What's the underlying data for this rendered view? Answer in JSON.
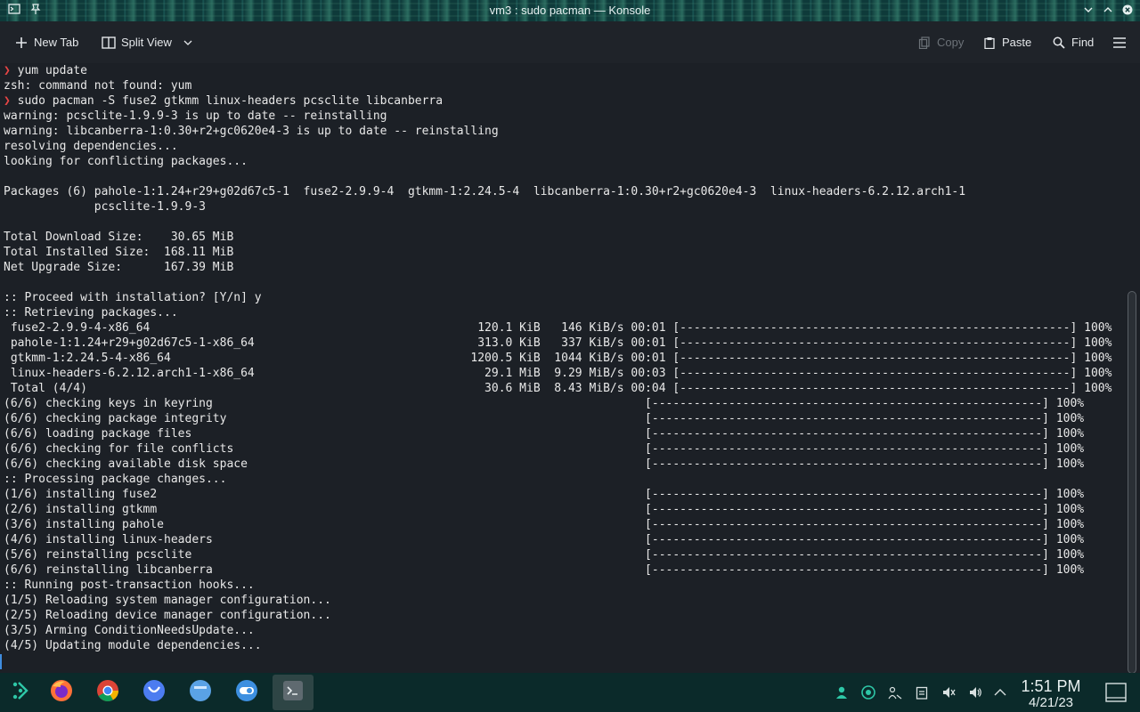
{
  "window": {
    "title": "vm3 : sudo pacman — Konsole"
  },
  "toolbar": {
    "new_tab": "New Tab",
    "split_view": "Split View",
    "copy": "Copy",
    "paste": "Paste",
    "find": "Find"
  },
  "terminal": {
    "lines": [
      {
        "prompt": "❯",
        "text": " yum update"
      },
      {
        "text": "zsh: command not found: yum"
      },
      {
        "prompt": "❯",
        "text": " sudo pacman -S fuse2 gtkmm linux-headers pcsclite libcanberra"
      },
      {
        "text": "warning: pcsclite-1.9.9-3 is up to date -- reinstalling"
      },
      {
        "text": "warning: libcanberra-1:0.30+r2+gc0620e4-3 is up to date -- reinstalling"
      },
      {
        "text": "resolving dependencies..."
      },
      {
        "text": "looking for conflicting packages..."
      },
      {
        "text": ""
      },
      {
        "text": "Packages (6) pahole-1:1.24+r29+g02d67c5-1  fuse2-2.9.9-4  gtkmm-1:2.24.5-4  libcanberra-1:0.30+r2+gc0620e4-3  linux-headers-6.2.12.arch1-1"
      },
      {
        "text": "             pcsclite-1.9.9-3"
      },
      {
        "text": ""
      },
      {
        "text": "Total Download Size:    30.65 MiB"
      },
      {
        "text": "Total Installed Size:  168.11 MiB"
      },
      {
        "text": "Net Upgrade Size:      167.39 MiB"
      },
      {
        "text": ""
      },
      {
        "text": ":: Proceed with installation? [Y/n] y"
      },
      {
        "text": ":: Retrieving packages..."
      },
      {
        "text": " fuse2-2.9.9-4-x86_64                                               120.1 KiB   146 KiB/s 00:01 [--------------------------------------------------------] 100%"
      },
      {
        "text": " pahole-1:1.24+r29+g02d67c5-1-x86_64                                313.0 KiB   337 KiB/s 00:01 [--------------------------------------------------------] 100%"
      },
      {
        "text": " gtkmm-1:2.24.5-4-x86_64                                           1200.5 KiB  1044 KiB/s 00:01 [--------------------------------------------------------] 100%"
      },
      {
        "text": " linux-headers-6.2.12.arch1-1-x86_64                                 29.1 MiB  9.29 MiB/s 00:03 [--------------------------------------------------------] 100%"
      },
      {
        "text": " Total (4/4)                                                         30.6 MiB  8.43 MiB/s 00:04 [--------------------------------------------------------] 100%"
      },
      {
        "text": "(6/6) checking keys in keyring                                                              [--------------------------------------------------------] 100%"
      },
      {
        "text": "(6/6) checking package integrity                                                            [--------------------------------------------------------] 100%"
      },
      {
        "text": "(6/6) loading package files                                                                 [--------------------------------------------------------] 100%"
      },
      {
        "text": "(6/6) checking for file conflicts                                                           [--------------------------------------------------------] 100%"
      },
      {
        "text": "(6/6) checking available disk space                                                         [--------------------------------------------------------] 100%"
      },
      {
        "text": ":: Processing package changes..."
      },
      {
        "text": "(1/6) installing fuse2                                                                      [--------------------------------------------------------] 100%"
      },
      {
        "text": "(2/6) installing gtkmm                                                                      [--------------------------------------------------------] 100%"
      },
      {
        "text": "(3/6) installing pahole                                                                     [--------------------------------------------------------] 100%"
      },
      {
        "text": "(4/6) installing linux-headers                                                              [--------------------------------------------------------] 100%"
      },
      {
        "text": "(5/6) reinstalling pcsclite                                                                 [--------------------------------------------------------] 100%"
      },
      {
        "text": "(6/6) reinstalling libcanberra                                                              [--------------------------------------------------------] 100%"
      },
      {
        "text": ":: Running post-transaction hooks..."
      },
      {
        "text": "(1/5) Reloading system manager configuration..."
      },
      {
        "text": "(2/5) Reloading device manager configuration..."
      },
      {
        "text": "(3/5) Arming ConditionNeedsUpdate..."
      },
      {
        "text": "(4/5) Updating module dependencies..."
      }
    ]
  },
  "taskbar": {
    "apps": [
      {
        "name": "app-launcher",
        "icon": "kde-launcher-icon"
      },
      {
        "name": "firefox",
        "icon": "firefox-icon"
      },
      {
        "name": "chrome",
        "icon": "chrome-icon"
      },
      {
        "name": "discover",
        "icon": "discover-icon"
      },
      {
        "name": "dolphin",
        "icon": "folder-icon"
      },
      {
        "name": "system-settings",
        "icon": "settings-toggle-icon"
      },
      {
        "name": "konsole",
        "icon": "terminal-icon",
        "active": true
      }
    ],
    "tray": [
      "user-icon",
      "update-icon",
      "network-icon",
      "clipboard-icon",
      "mute-icon",
      "volume-icon",
      "expand-arrow-icon"
    ],
    "clock": {
      "time": "1:51 PM",
      "date": "4/21/23"
    }
  },
  "colors": {
    "accent": "#3f8cde",
    "prompt": "#e64545",
    "titlebar": "#0e3a3a",
    "taskbar": "#0b2a2a"
  }
}
